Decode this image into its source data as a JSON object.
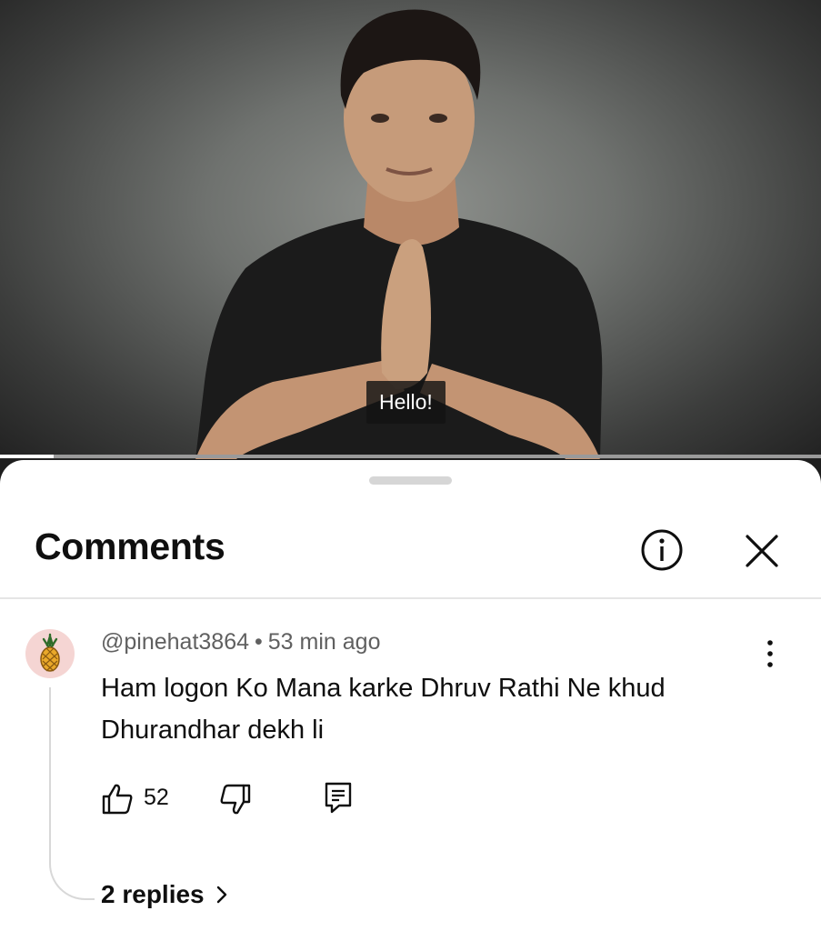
{
  "video": {
    "caption": "Hello!",
    "progress_fraction": 0.065
  },
  "comments_panel": {
    "title": "Comments",
    "info_icon": "info-icon",
    "close_icon": "close-icon"
  },
  "comment": {
    "username": "@pinehat3864",
    "separator": "•",
    "time": "53 min ago",
    "text": "Ham logon Ko Mana karke Dhruv Rathi Ne khud Dhurandhar dekh li",
    "like_count": "52",
    "replies_label": "2 replies",
    "avatar_icon": "pineapple-icon",
    "like_icon": "thumbs-up-icon",
    "dislike_icon": "thumbs-down-icon",
    "reply_icon": "reply-icon",
    "more_icon": "more-vertical-icon",
    "chevron_icon": "chevron-right-icon"
  },
  "colors": {
    "sheet_bg": "#ffffff",
    "text_primary": "#0f0f0f",
    "text_secondary": "#606060",
    "avatar_bg": "#f5d5d3"
  }
}
